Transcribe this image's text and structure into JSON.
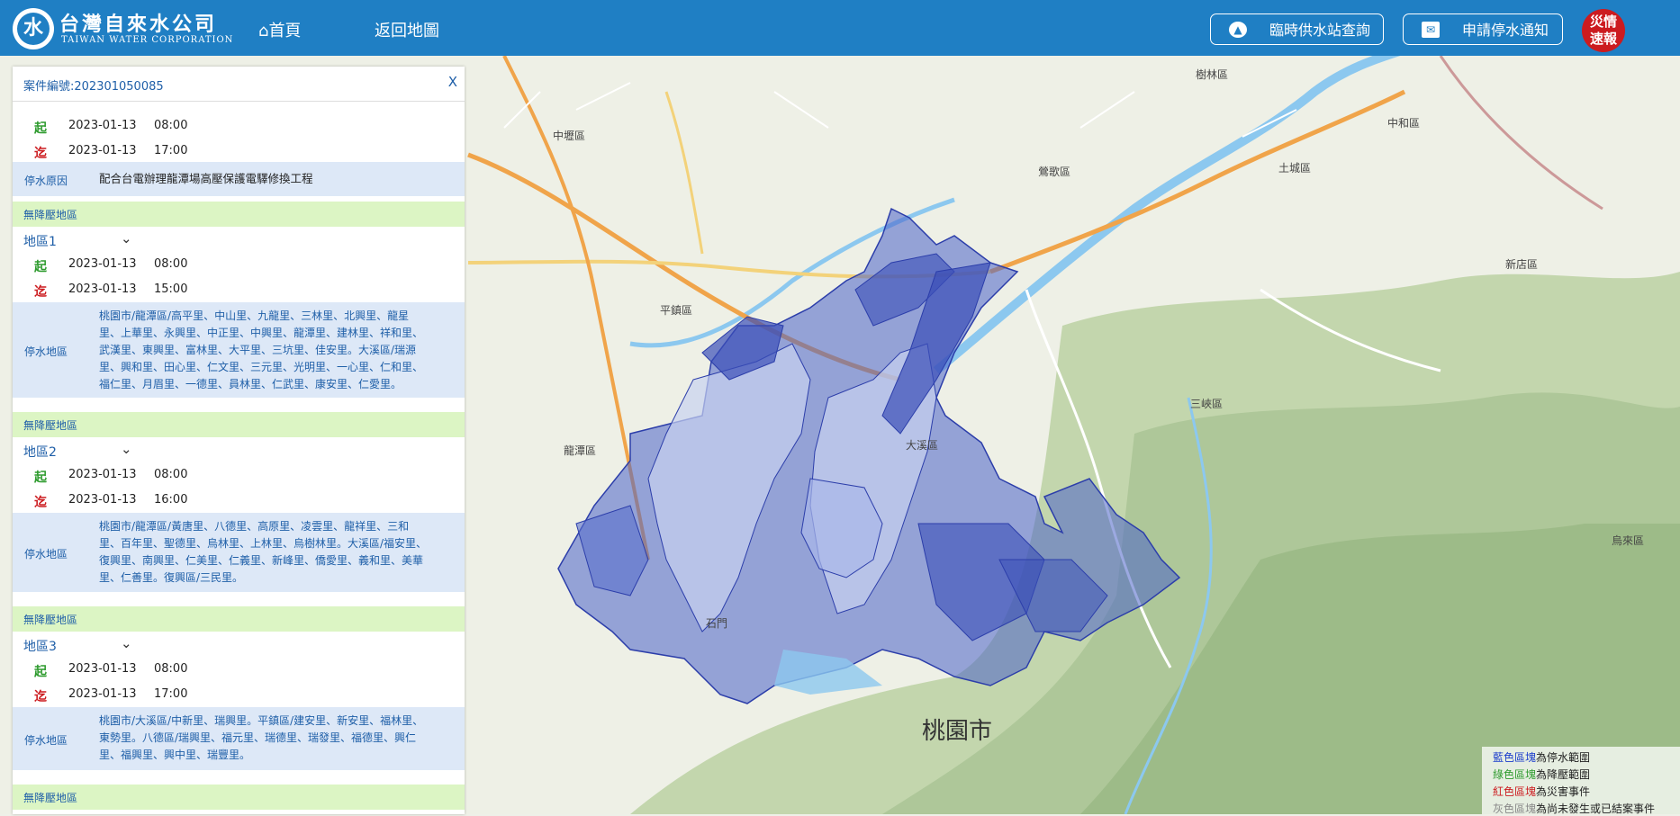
{
  "header": {
    "brand_zh": "台灣自來水公司",
    "brand_en": "TAIWAN WATER CORPORATION",
    "nav_home": "首頁",
    "nav_back": "返回地圖",
    "station_button": "臨時供水站查詢",
    "notify_button": "申請停水通知",
    "disaster_line1": "災情",
    "disaster_line2": "速報"
  },
  "panel": {
    "case_number": "案件編號:202301050085",
    "close_label": "X",
    "start_tag": "起",
    "end_tag": "迄",
    "start_date": "2023-01-13",
    "start_time": "08:00",
    "end_date": "2023-01-13",
    "end_time": "17:00",
    "reason_label": "停水原因",
    "reason": "配合台電辦理龍潭場高壓保護電驛修換工程",
    "areas": [
      {
        "section_label": "無降壓地區",
        "title": "地區1",
        "start_date": "2023-01-13",
        "start_time": "08:00",
        "end_date": "2023-01-13",
        "end_time": "15:00",
        "area_label": "停水地區",
        "text_lines": [
          "桃園市/龍潭區/高平里、中山里、九龍里、三林里、北興里、龍星",
          "里、上華里、永興里、中正里、中興里、龍潭里、建林里、祥和里、",
          "武漢里、東興里、富林里、大平里、三坑里、佳安里。大溪區/瑞源",
          "里、興和里、田心里、仁文里、三元里、光明里、一心里、仁和里、",
          "福仁里、月眉里、一德里、員林里、仁武里、康安里、仁愛里。"
        ]
      },
      {
        "section_label": "無降壓地區",
        "title": "地區2",
        "start_date": "2023-01-13",
        "start_time": "08:00",
        "end_date": "2023-01-13",
        "end_time": "16:00",
        "area_label": "停水地區",
        "text_lines": [
          "桃園市/龍潭區/黃唐里、八德里、高原里、凌雲里、龍祥里、三和",
          "里、百年里、聖德里、烏林里、上林里、烏樹林里。大溪區/福安里、",
          "復興里、南興里、仁美里、仁義里、新峰里、僑愛里、義和里、美華",
          "里、仁善里。復興區/三民里。"
        ]
      },
      {
        "section_label": "無降壓地區",
        "title": "地區3",
        "start_date": "2023-01-13",
        "start_time": "08:00",
        "end_date": "2023-01-13",
        "end_time": "17:00",
        "area_label": "停水地區",
        "text_lines": [
          "桃園市/大溪區/中新里、瑞興里。平鎮區/建安里、新安里、福林里、",
          "東勢里。八德區/瑞興里、福元里、瑞德里、瑞發里、福德里、興仁",
          "里、福興里、興中里、瑞豐里。"
        ]
      }
    ],
    "last_section_label": "無降壓地區"
  },
  "map": {
    "city_label": "桃園市",
    "district_labels": [
      "中壢區",
      "平鎮區",
      "龍潭區",
      "大溪區",
      "鶯歌區",
      "土城區",
      "三峽區",
      "中和區",
      "樹林區",
      "新店區",
      "烏來區",
      "石門"
    ],
    "colors": {
      "outage": "#4a62c8",
      "terrain": "#b9cfa3",
      "water": "#8cc8ef"
    }
  },
  "legend": [
    {
      "colored": "藍色區塊",
      "rest": "為停水範圍",
      "color": "#1a3ccc"
    },
    {
      "colored": "綠色區塊",
      "rest": "為降壓範圍",
      "color": "#2e9b2e"
    },
    {
      "colored": "紅色區塊",
      "rest": "為災害事件",
      "color": "#cc1b1f"
    },
    {
      "colored": "灰色區塊",
      "rest": "為尚未發生或已結案事件",
      "color": "#888888"
    }
  ]
}
